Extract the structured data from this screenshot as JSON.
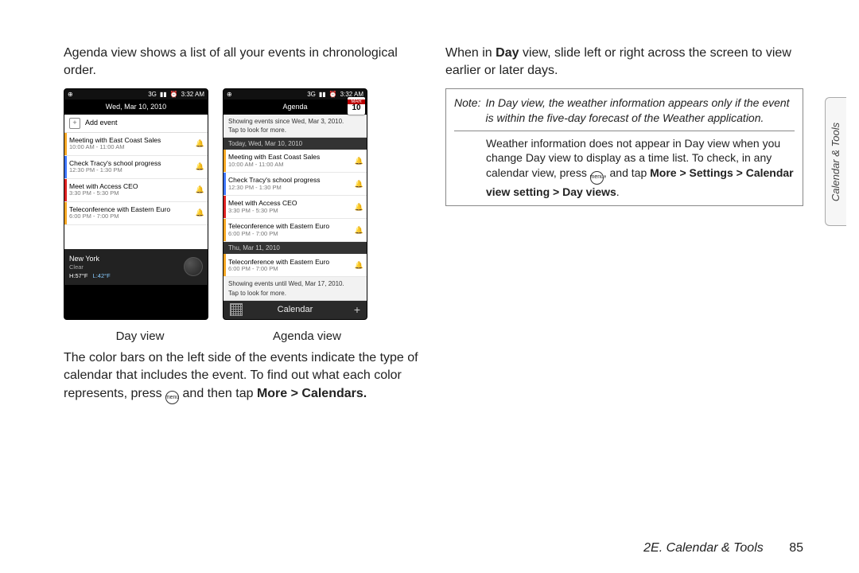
{
  "left": {
    "intro": "Agenda view shows a list of all your events in chronological order.",
    "captions": {
      "day": "Day view",
      "agenda": "Agenda view"
    },
    "para2": "The color bars on the left side of the events indicate the type of calendar that includes the event. To find out what each color represents, press",
    "para2_tail": "and then tap",
    "bold_path": "More > Calendars."
  },
  "menu_icon_label": "menu",
  "day_phone": {
    "status_left": "⊕",
    "status_right": {
      "net": "3G",
      "sig": "▮▮",
      "clock": "⏰",
      "time": "3:32 AM"
    },
    "date": "Wed, Mar 10, 2010",
    "add_event": "Add event",
    "events": [
      {
        "color": "#f5a623",
        "title": "Meeting with East Coast Sales",
        "time": "10:00 AM - 11:00 AM"
      },
      {
        "color": "#3f76ff",
        "title": "Check Tracy's school progress",
        "time": "12:30 PM - 1:30 PM"
      },
      {
        "color": "#d22",
        "title": "Meet with Access CEO",
        "time": "3:30 PM - 5:30 PM"
      },
      {
        "color": "#f5a623",
        "title": "Teleconference with Eastern Euro",
        "time": "6:00 PM - 7:00 PM"
      }
    ],
    "weather": {
      "city": "New York",
      "cond": "Clear",
      "hi": "H:57°F",
      "lo": "L:42°F"
    }
  },
  "agenda_phone": {
    "status_left": "⊕",
    "status_right": {
      "net": "3G",
      "sig": "▮▮",
      "clock": "⏰",
      "time": "3:32 AM"
    },
    "title": "Agenda",
    "badge": {
      "mon": "MAR",
      "day": "10"
    },
    "hint_top_a": "Showing events since Wed, Mar 3, 2010.",
    "hint_top_b": "Tap to look for more.",
    "sub1": "Today, Wed, Mar 10, 2010",
    "events1": [
      {
        "color": "#f5a623",
        "title": "Meeting with East Coast Sales",
        "time": "10:00 AM - 11:00 AM"
      },
      {
        "color": "#3f76ff",
        "title": "Check Tracy's school progress",
        "time": "12:30 PM - 1:30 PM"
      },
      {
        "color": "#d22",
        "title": "Meet with Access CEO",
        "time": "3:30 PM - 5:30 PM"
      },
      {
        "color": "#f5a623",
        "title": "Teleconference with Eastern Euro",
        "time": "6:00 PM - 7:00 PM"
      }
    ],
    "sub2": "Thu, Mar 11, 2010",
    "events2": [
      {
        "color": "#f5a623",
        "title": "Teleconference with Eastern Euro",
        "time": "6:00 PM - 7:00 PM"
      }
    ],
    "hint_bot_a": "Showing events until Wed, Mar 17, 2010.",
    "hint_bot_b": "Tap to look for more.",
    "appbar": "Calendar"
  },
  "right": {
    "para1_a": "When in ",
    "para1_bold": "Day",
    "para1_b": " view, slide left or right across the screen to view earlier or later days.",
    "note_label": "Note:",
    "note1": "In Day view, the weather information appears only if the event is within the five-day forecast of the Weather application.",
    "note2_a": "Weather information does not appear in Day view when you change Day view to display as a time list. To check, in any calendar view, press ",
    "note2_b": ", and tap ",
    "note2_bold1": "More > Settings > Calendar view setting > Day views",
    "note2_tail": "."
  },
  "sidetab": "Calendar & Tools",
  "footer": {
    "section": "2E. Calendar & Tools",
    "page": "85"
  }
}
